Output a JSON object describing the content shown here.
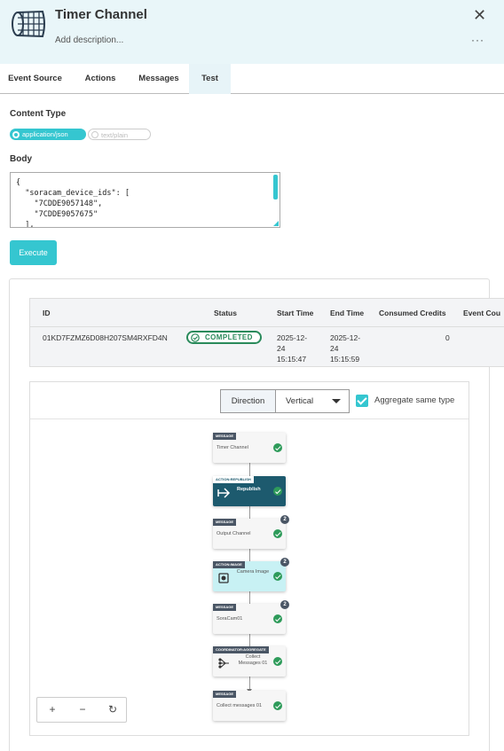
{
  "header": {
    "title": "Timer Channel",
    "description_placeholder": "Add description...",
    "close_icon": "close-icon",
    "more_icon": "more-options-icon",
    "close_glyph": "✕",
    "more_glyph": "···",
    "logo_icon": "net-icon"
  },
  "tabs": [
    {
      "label": "Event Source",
      "active": false
    },
    {
      "label": "Actions",
      "active": false
    },
    {
      "label": "Messages",
      "active": false
    },
    {
      "label": "Test",
      "active": true
    }
  ],
  "test": {
    "content_type_label": "Content Type",
    "content_types": [
      {
        "label": "application/json",
        "selected": true
      },
      {
        "label": "text/plain",
        "selected": false
      }
    ],
    "body_label": "Body",
    "body_value": "{\n  \"soracam_device_ids\": [\n    \"7CDDE9057148\",\n    \"7CDDE9057675\"\n  ],",
    "execute_label": "Execute"
  },
  "results": {
    "columns": [
      "ID",
      "Status",
      "Start Time",
      "End Time",
      "Consumed Credits",
      "Event Cou"
    ],
    "rows": [
      {
        "id": "01KD7FZMZ6D08H207SM4RXFD4N",
        "status": "COMPLETED",
        "start_time": "2025-12-\n24\n15:15:47",
        "end_time": "2025-12-\n24\n15:15:59",
        "consumed_credits": "0",
        "event_count": ""
      }
    ]
  },
  "flow": {
    "direction_label": "Direction",
    "direction_value": "Vertical",
    "aggregate_label": "Aggregate same type",
    "aggregate_checked": true,
    "nodes": [
      {
        "tag": "MESSAGE",
        "name": "Timer Channel",
        "style": "light",
        "count": ""
      },
      {
        "tag": "ACTION:REPUBLISH",
        "name": "Republish",
        "style": "dark",
        "count": ""
      },
      {
        "tag": "MESSAGE",
        "name": "Output Channel",
        "style": "light",
        "count": "2"
      },
      {
        "tag": "ACTION:IMAGE",
        "name": "Camera Image",
        "style": "cyan",
        "count": "2"
      },
      {
        "tag": "MESSAGE",
        "name": "SoraCam01",
        "style": "light",
        "count": "2"
      },
      {
        "tag": "COORDINATOR:AGGREGATE",
        "name": "Collect Messages 01",
        "style": "light",
        "count": ""
      },
      {
        "tag": "MESSAGE",
        "name": "Collect messages 01",
        "style": "light",
        "count": ""
      }
    ],
    "zoom_in": "+",
    "zoom_out": "−",
    "reset": "↻"
  },
  "colors": {
    "accent": "#35c6d0",
    "header_bg": "#e9f6f9",
    "success": "#2e9b5a",
    "dark_node": "#1d5a6e"
  }
}
